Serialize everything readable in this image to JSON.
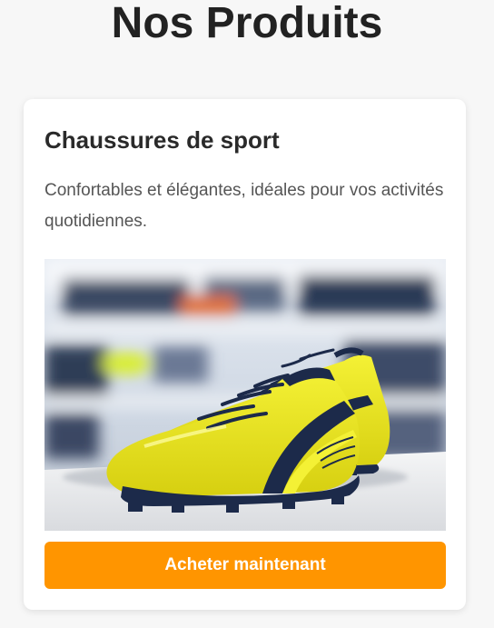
{
  "page": {
    "title": "Nos Produits"
  },
  "product": {
    "name": "Chaussures de sport",
    "description": "Confortables et élégantes, idéales pour vos activités quotidiennes.",
    "image_subject": "yellow-football-boots",
    "buy_label": "Acheter maintenant"
  },
  "colors": {
    "page_background": "#f7f7f7",
    "card_background": "#ffffff",
    "button_accent": "#ff9500",
    "title_text": "#222222",
    "description_text": "#555555",
    "shoe_yellow": "#e6e218",
    "shoe_navy": "#1c2a4a"
  }
}
